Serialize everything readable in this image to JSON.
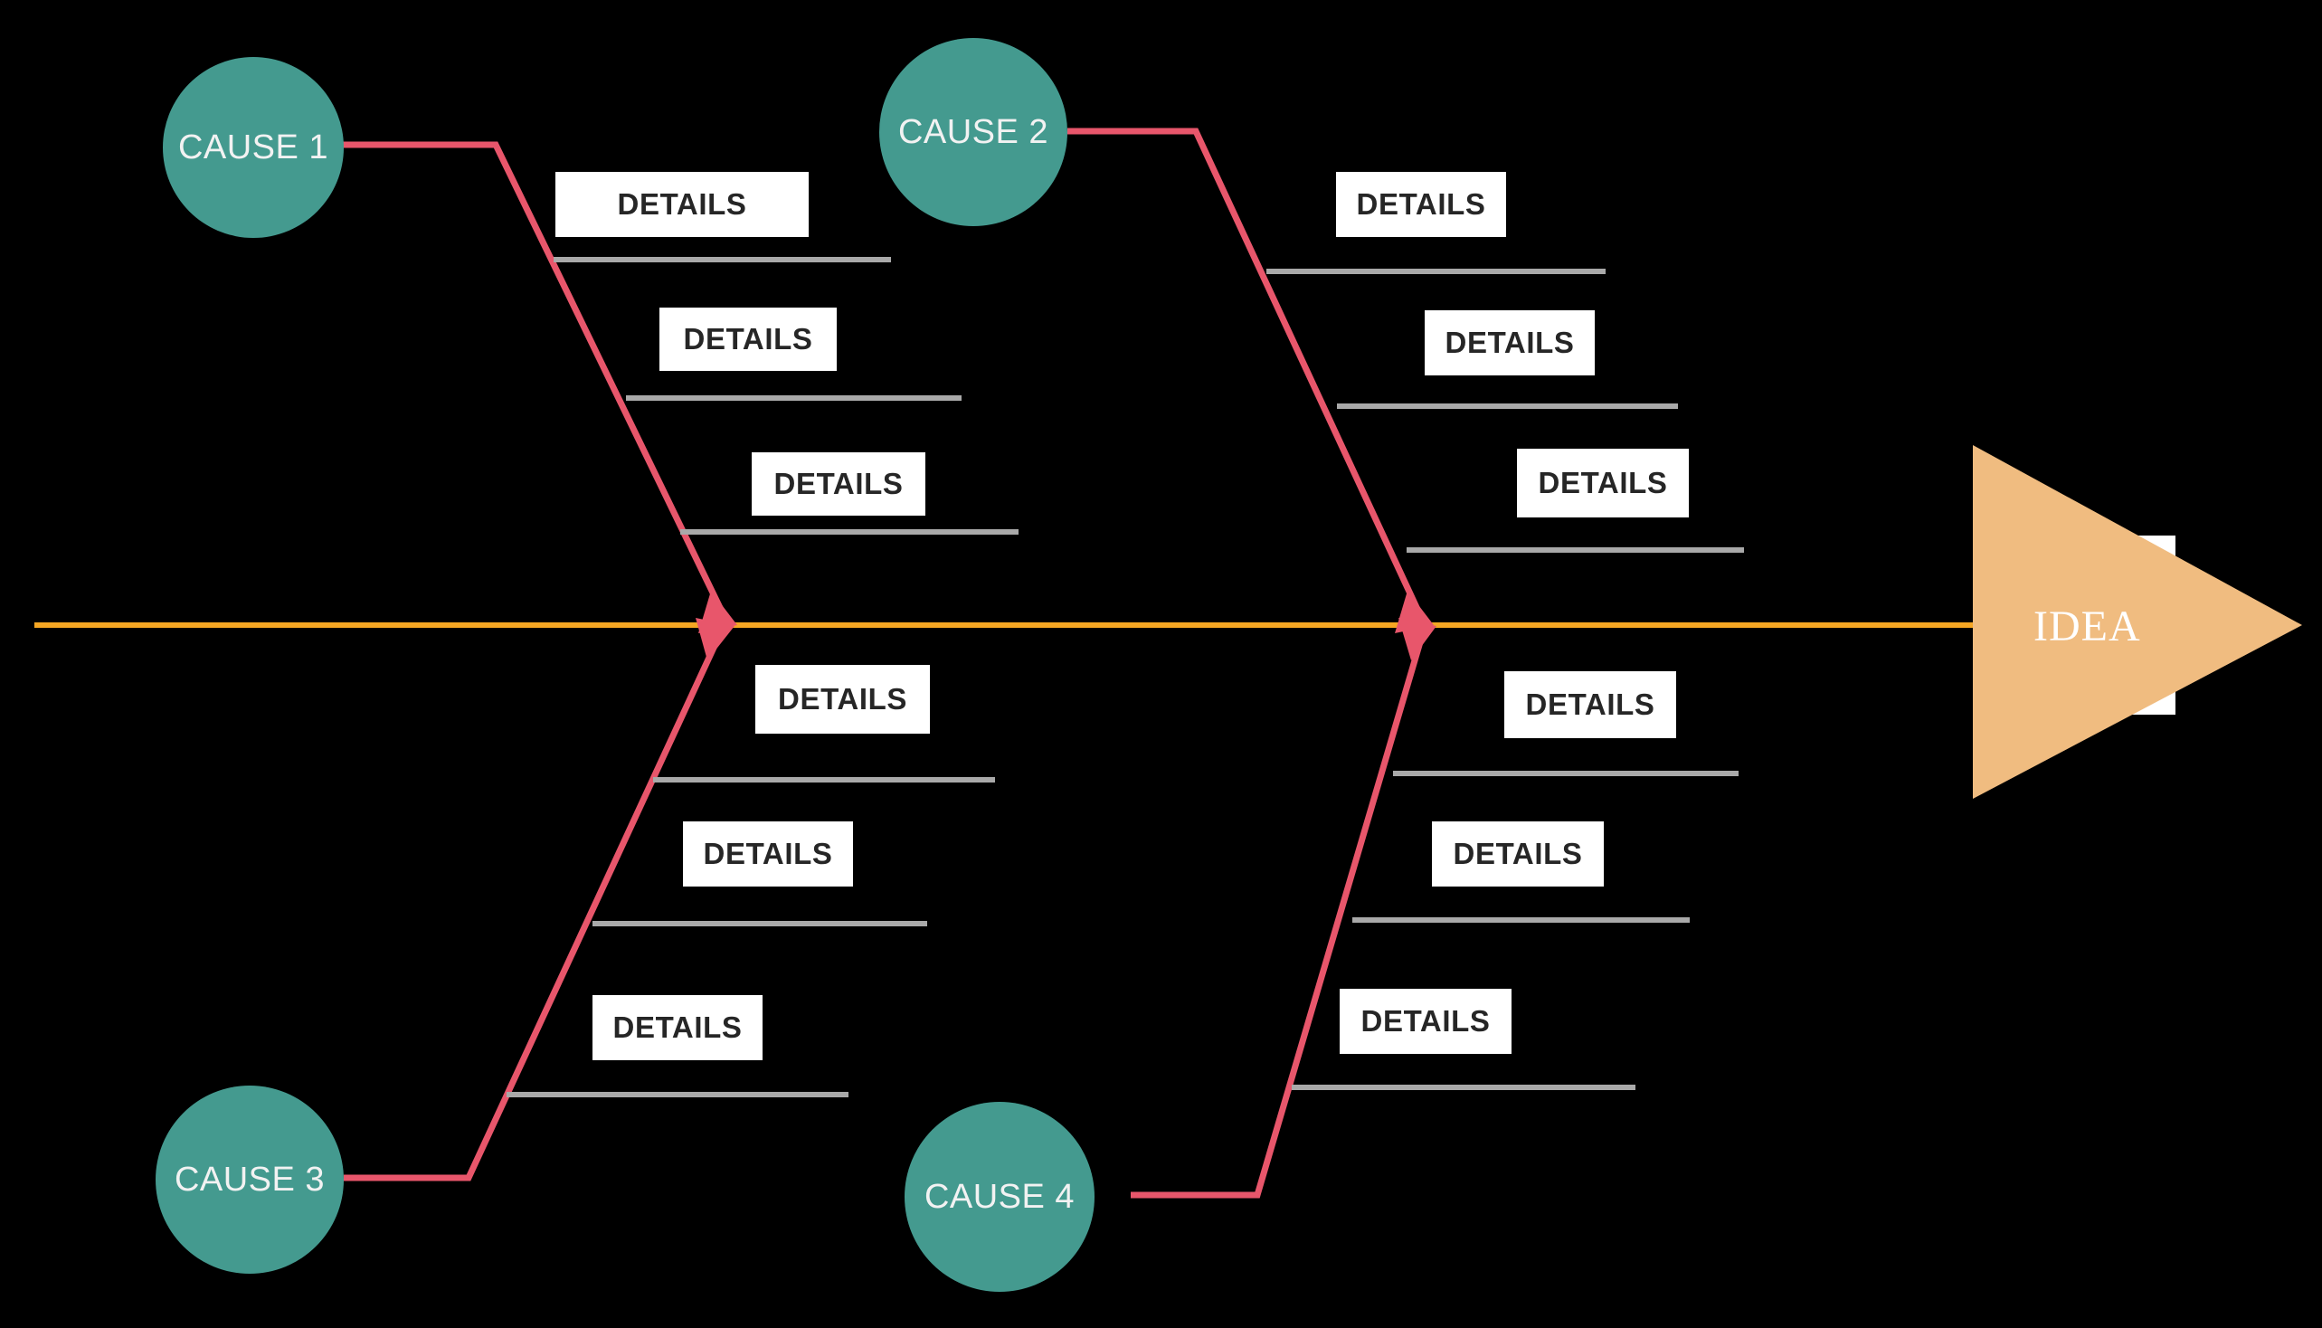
{
  "diagram": {
    "type": "fishbone-ishikawa",
    "title_node": {
      "label": "IDEA"
    },
    "background_color": "#000000",
    "colors": {
      "cause_circle": "#449A8F",
      "cause_text": "#F2F2F2",
      "bone_line": "#E8566B",
      "spine_line": "#F5A623",
      "idea_arrow": "#F0BC80",
      "detail_box_bg": "#FFFFFF",
      "detail_box_text": "#262626",
      "detail_rule": "#A9A9A9"
    },
    "causes": [
      {
        "id": "cause-1",
        "label": "CAUSE 1",
        "position": "top-left",
        "details": [
          {
            "label": "DETAILS"
          },
          {
            "label": "DETAILS"
          },
          {
            "label": "DETAILS"
          }
        ]
      },
      {
        "id": "cause-2",
        "label": "CAUSE 2",
        "position": "top-right",
        "details": [
          {
            "label": "DETAILS"
          },
          {
            "label": "DETAILS"
          },
          {
            "label": "DETAILS"
          }
        ]
      },
      {
        "id": "cause-3",
        "label": "CAUSE 3",
        "position": "bottom-left",
        "details": [
          {
            "label": "DETAILS"
          },
          {
            "label": "DETAILS"
          },
          {
            "label": "DETAILS"
          }
        ]
      },
      {
        "id": "cause-4",
        "label": "CAUSE 4",
        "position": "bottom-right",
        "details": [
          {
            "label": "DETAILS"
          },
          {
            "label": "DETAILS"
          },
          {
            "label": "DETAILS"
          }
        ]
      }
    ]
  }
}
